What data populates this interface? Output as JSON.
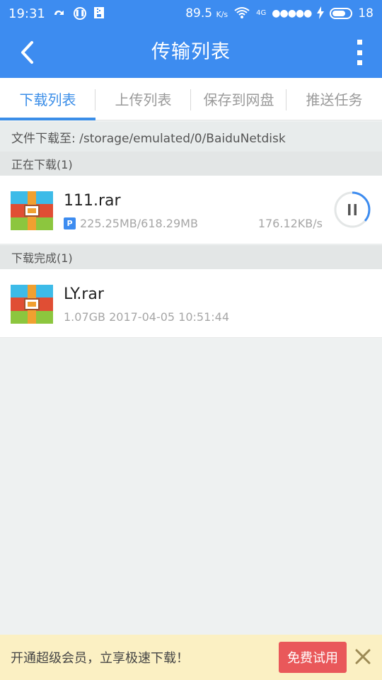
{
  "status_bar": {
    "time": "19:31",
    "network_speed": "89.5",
    "network_speed_unit": "K/s",
    "signal_label": "4G",
    "battery_level": "18"
  },
  "app_bar": {
    "title": "传输列表"
  },
  "tabs": [
    {
      "label": "下载列表",
      "active": true
    },
    {
      "label": "上传列表",
      "active": false
    },
    {
      "label": "保存到网盘",
      "active": false
    },
    {
      "label": "推送任务",
      "active": false
    }
  ],
  "download_path": "文件下载至: /storage/emulated/0/BaiduNetdisk",
  "downloading": {
    "header": "正在下载(1)",
    "items": [
      {
        "name": "111.rar",
        "badge": "P",
        "progress_text": "225.25MB/618.29MB",
        "speed": "176.12KB/s",
        "progress": 0.364
      }
    ]
  },
  "completed": {
    "header": "下载完成(1)",
    "items": [
      {
        "name": "LY.rar",
        "meta": "1.07GB 2017-04-05 10:51:44"
      }
    ]
  },
  "promo": {
    "message": "开通超级会员，立享极速下载！",
    "button_label": "免费试用"
  },
  "colors": {
    "primary": "#3d8cf0",
    "tab_active": "#3b8ee8",
    "promo_bg": "#fbf0c3",
    "promo_button": "#e9585a"
  }
}
